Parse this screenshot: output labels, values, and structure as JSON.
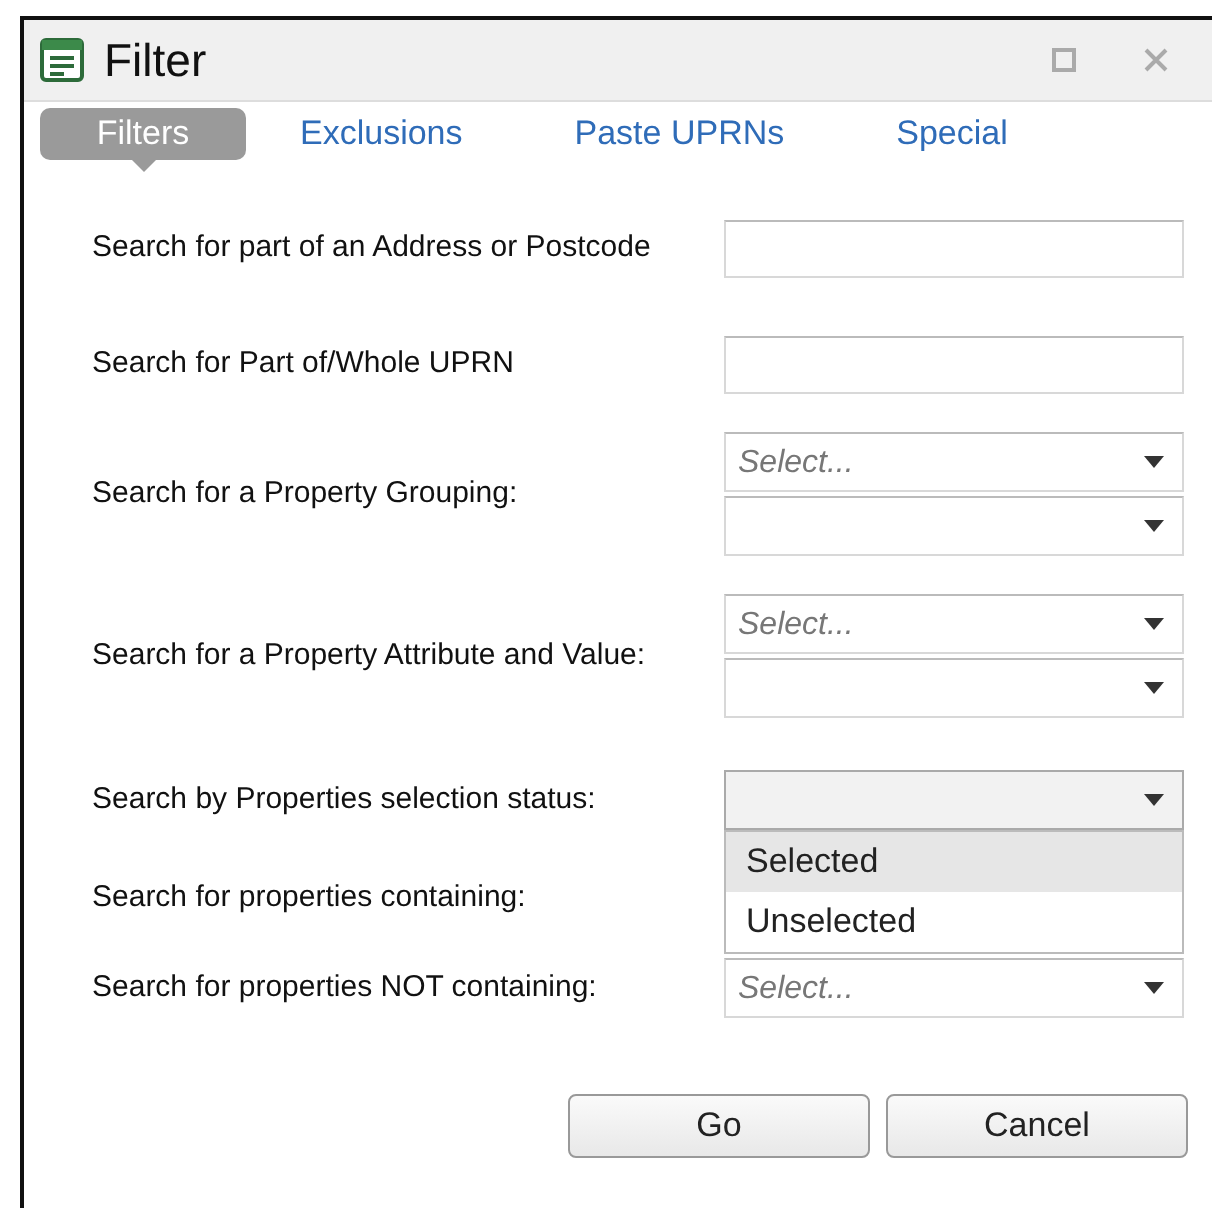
{
  "window": {
    "title": "Filter"
  },
  "tabs": [
    {
      "label": "Filters",
      "selected": true
    },
    {
      "label": "Exclusions",
      "selected": false
    },
    {
      "label": "Paste UPRNs",
      "selected": false
    },
    {
      "label": "Special",
      "selected": false
    }
  ],
  "rows": [
    {
      "label": "Search for part of an Address or Postcode",
      "kind": "text"
    },
    {
      "label": "Search for Part of/Whole UPRN",
      "kind": "text"
    },
    {
      "label": "Search for a Property Grouping:",
      "kind": "select_pair",
      "placeholder": "Select..."
    },
    {
      "label": "Search for a Property Attribute and Value:",
      "kind": "select_pair",
      "placeholder": "Select..."
    },
    {
      "label": "Search by Properties selection status:",
      "kind": "select",
      "open": true,
      "options": [
        {
          "label": "Selected",
          "selected": true
        },
        {
          "label": "Unselected",
          "selected": false
        }
      ]
    },
    {
      "label": "Search for properties containing:",
      "kind": "covered"
    },
    {
      "label": "Search for properties NOT containing:",
      "kind": "select",
      "placeholder": "Select...",
      "open": false
    }
  ],
  "buttons": [
    "Go",
    "Cancel"
  ]
}
